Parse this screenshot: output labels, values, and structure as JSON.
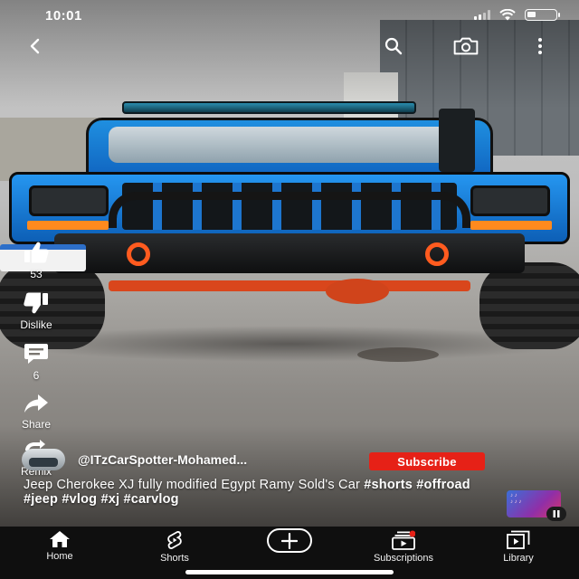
{
  "status_bar": {
    "time": "10:01",
    "battery_level": 0.3
  },
  "top_controls": {
    "back_icon": "chevron-left-icon",
    "search_icon": "search-icon",
    "camera_icon": "camera-icon",
    "more_icon": "more-vertical-icon"
  },
  "actions": {
    "like_count": "53",
    "dislike_label": "Dislike",
    "comment_count": "6",
    "share_label": "Share",
    "remix_label": "Remix"
  },
  "channel": {
    "name": "@ITzCarSpotter-Mohamed...",
    "subscribe_label": "Subscribe"
  },
  "video": {
    "title_text": "Jeep Cherokee XJ fully modified Egypt Ramy Sold's Car",
    "hashtags": [
      "#shorts",
      "#offroad",
      "#jeep",
      "#vlog",
      "#xj",
      "#carvlog"
    ]
  },
  "bottom_nav": {
    "items": [
      {
        "label": "Home",
        "icon": "home-icon"
      },
      {
        "label": "Shorts",
        "icon": "shorts-icon"
      },
      {
        "label": "",
        "icon": "plus-icon"
      },
      {
        "label": "Subscriptions",
        "icon": "subscriptions-icon"
      },
      {
        "label": "Library",
        "icon": "library-icon"
      }
    ]
  },
  "colors": {
    "subscribe_red": "#e62117",
    "nav_bg": "#0f0f0f"
  }
}
